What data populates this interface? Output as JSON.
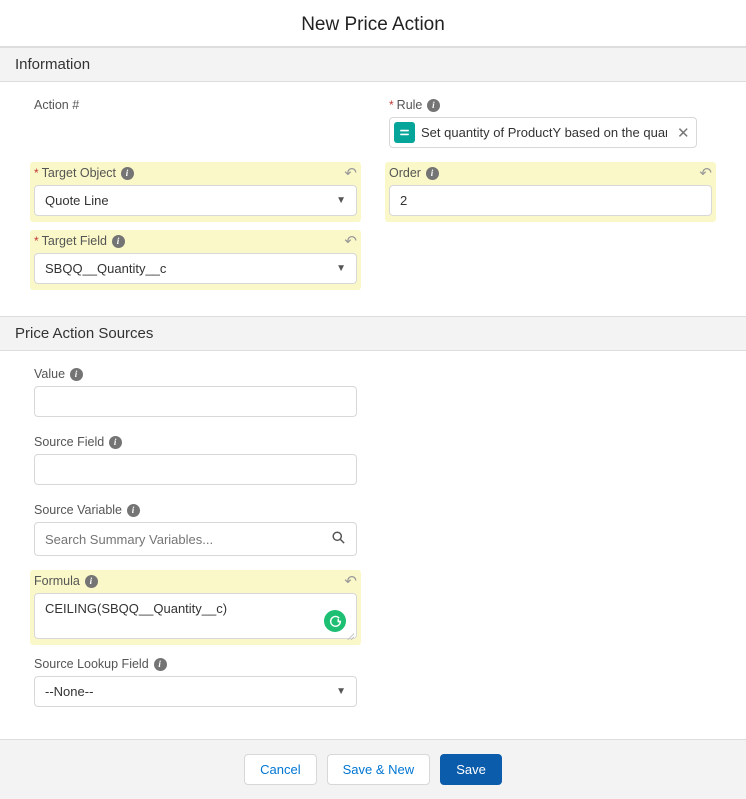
{
  "title": "New Price Action",
  "sections": {
    "information": "Information",
    "sources": "Price Action Sources"
  },
  "fields": {
    "action_number": {
      "label": "Action #",
      "value": ""
    },
    "rule": {
      "label": "Rule",
      "chip_text": "Set quantity of ProductY based on the quantity o"
    },
    "target_object": {
      "label": "Target Object",
      "value": "Quote Line"
    },
    "order": {
      "label": "Order",
      "value": "2"
    },
    "target_field": {
      "label": "Target Field",
      "value": "SBQQ__Quantity__c"
    },
    "value": {
      "label": "Value",
      "value": ""
    },
    "source_field": {
      "label": "Source Field",
      "value": ""
    },
    "source_variable": {
      "label": "Source Variable",
      "placeholder": "Search Summary Variables..."
    },
    "formula": {
      "label": "Formula",
      "value": "CEILING(SBQQ__Quantity__c)"
    },
    "source_lookup_field": {
      "label": "Source Lookup Field",
      "value": "--None--"
    }
  },
  "buttons": {
    "cancel": "Cancel",
    "save_new": "Save & New",
    "save": "Save"
  }
}
